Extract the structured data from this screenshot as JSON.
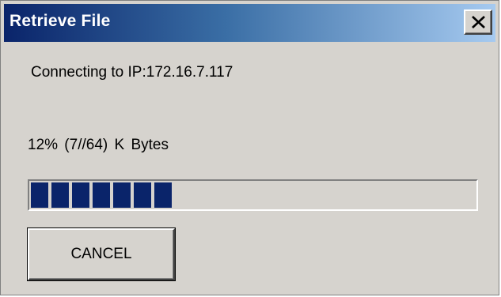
{
  "window": {
    "title": "Retrieve File",
    "close_icon": "close-icon"
  },
  "status": {
    "connection_text": "Connecting to IP:172.16.7.117",
    "progress_text": "12%   (7//64) K Bytes"
  },
  "progress": {
    "percent": 12,
    "fraction": 0.12,
    "blocks_filled": 7,
    "bar_color": "#0a246a"
  },
  "buttons": {
    "cancel_label": "CANCEL"
  },
  "colors": {
    "titlebar_start": "#0a246a",
    "titlebar_end": "#a6caf0",
    "dialog_face": "#d6d3ce"
  }
}
